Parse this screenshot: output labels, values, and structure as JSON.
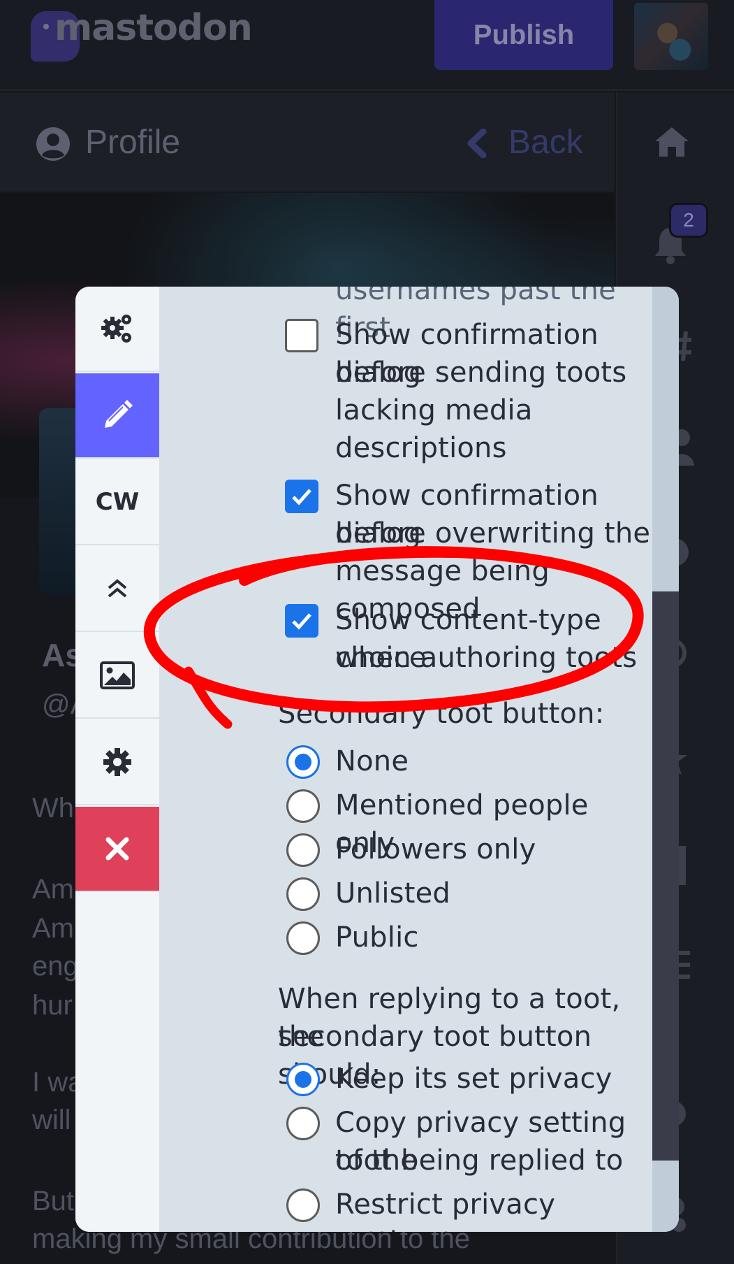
{
  "header": {
    "logo_text": "mastodon",
    "publish_label": "Publish"
  },
  "column": {
    "title": "Profile",
    "back_label": "Back"
  },
  "notifications_badge": "2",
  "background_text": {
    "name_fragment": "As",
    "handle_fragment": "@A",
    "line1": "Wh",
    "line2": "Am",
    "line3": "Am",
    "line4": "eng",
    "line5": "hur",
    "line6": "I wa",
    "line7": "will",
    "line8": "But",
    "line9": "making my small contribution to the"
  },
  "modal": {
    "tabs": [
      {
        "icon": "cogs-icon"
      },
      {
        "icon": "pencil-icon",
        "active": true
      },
      {
        "label": "CW"
      },
      {
        "icon": "double-chevron-up-icon"
      },
      {
        "icon": "image-icon"
      },
      {
        "icon": "gear-icon"
      },
      {
        "icon": "close-icon"
      }
    ],
    "cutoff_text": "usernames past the first",
    "checkboxes": [
      {
        "label_lines": [
          "Show confirmation dialog",
          "before sending toots",
          "lacking media",
          "descriptions"
        ],
        "checked": false
      },
      {
        "label_lines": [
          "Show confirmation dialog",
          "before overwriting the",
          "message being composed"
        ],
        "checked": true
      },
      {
        "label_lines": [
          "Show content-type choice",
          "when authoring toots"
        ],
        "checked": true
      }
    ],
    "secondary_button_heading": "Secondary toot button:",
    "secondary_options": [
      "None",
      "Mentioned people only",
      "Followers only",
      "Unlisted",
      "Public"
    ],
    "secondary_selected": "None",
    "reply_heading_lines": [
      "When replying to a toot, the",
      "secondary toot button should:"
    ],
    "reply_options": [
      {
        "lines": [
          "Keep its set privacy"
        ],
        "checked": true
      },
      {
        "lines": [
          "Copy privacy setting of the",
          "toot being replied to"
        ],
        "checked": false
      },
      {
        "lines": [
          "Restrict privacy setting to"
        ],
        "checked": false
      }
    ]
  },
  "colors": {
    "accent": "#6364ff",
    "danger": "#df405a",
    "checkbox_blue": "#1a73e8",
    "annotation_red": "#ff0000"
  }
}
